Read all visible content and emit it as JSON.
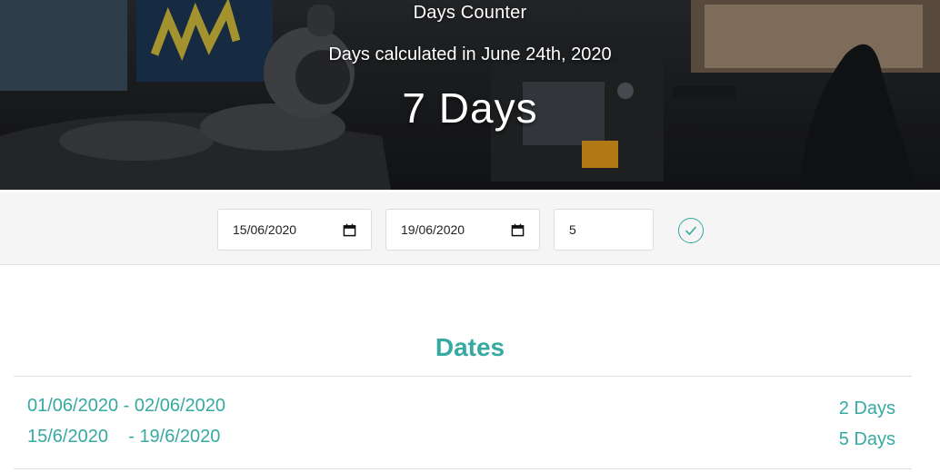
{
  "hero": {
    "title": "Days Counter",
    "subtitle": "Days calculated in  June 24th, 2020",
    "count": "7 Days"
  },
  "form": {
    "start_date": "15/06/2020",
    "end_date": "19/06/2020",
    "number_value": "5",
    "calendar_icon": "calendar-icon",
    "submit_icon": "check-circle-icon"
  },
  "dates": {
    "heading": "Dates",
    "rows": [
      {
        "start": "01/06/2020",
        "separator": " - ",
        "end": "02/06/2020",
        "days": "2 Days"
      },
      {
        "start": "15/6/2020",
        "separator": "    - ",
        "end": "19/6/2020",
        "days": "5 Days"
      }
    ]
  },
  "colors": {
    "accent": "#36aaa2",
    "form_background": "#f5f5f5"
  }
}
